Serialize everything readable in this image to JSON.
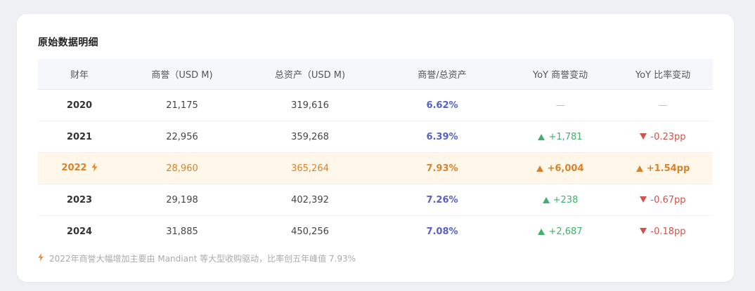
{
  "section_title": "原始数据明细",
  "table": {
    "headers": [
      "财年",
      "商誉（USD M)",
      "总资产（USD M)",
      "商誉/总资产",
      "YoY 商誉变动",
      "YoY 比率变动"
    ],
    "rows": [
      {
        "year": "2020",
        "goodwill": "21,175",
        "assets": "319,616",
        "ratio": "6.62%",
        "yoy_goodwill": "—",
        "yoy_goodwill_dir": "none",
        "yoy_ratio": "—",
        "yoy_ratio_dir": "none",
        "highlight": false
      },
      {
        "year": "2021",
        "goodwill": "22,956",
        "assets": "359,268",
        "ratio": "6.39%",
        "yoy_goodwill": "+1,781",
        "yoy_goodwill_dir": "up",
        "yoy_ratio": "-0.23pp",
        "yoy_ratio_dir": "down",
        "highlight": false
      },
      {
        "year": "2022",
        "goodwill": "28,960",
        "assets": "365,264",
        "ratio": "7.93%",
        "yoy_goodwill": "+6,004",
        "yoy_goodwill_dir": "up",
        "yoy_ratio": "+1.54pp",
        "yoy_ratio_dir": "up",
        "highlight": true
      },
      {
        "year": "2023",
        "goodwill": "29,198",
        "assets": "402,392",
        "ratio": "7.26%",
        "yoy_goodwill": "+238",
        "yoy_goodwill_dir": "up",
        "yoy_ratio": "-0.67pp",
        "yoy_ratio_dir": "down",
        "highlight": false
      },
      {
        "year": "2024",
        "goodwill": "31,885",
        "assets": "450,256",
        "ratio": "7.08%",
        "yoy_goodwill": "+2,687",
        "yoy_goodwill_dir": "up",
        "yoy_ratio": "-0.18pp",
        "yoy_ratio_dir": "down",
        "highlight": false
      }
    ]
  },
  "highlight_icon": "lightning-bolt-icon",
  "footnote": "2022年商誉大幅增加主要由 Mandiant 等大型收购驱动，比率创五年峰值 7.93%",
  "colors": {
    "ratio": "#5560c8",
    "up": "#3fb26b",
    "down": "#d1524a",
    "highlight_text": "#d9822b",
    "highlight_bg": "#fff8ea",
    "header_bg": "#f5f7fb"
  }
}
